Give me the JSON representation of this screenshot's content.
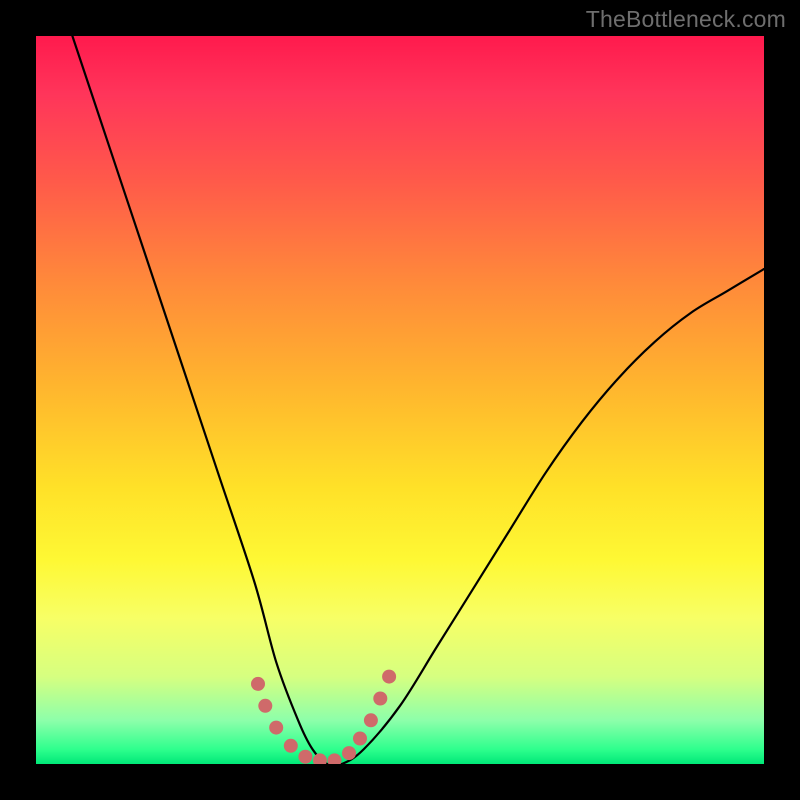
{
  "watermark": "TheBottleneck.com",
  "chart_data": {
    "type": "line",
    "title": "",
    "xlabel": "",
    "ylabel": "",
    "xlim": [
      0,
      100
    ],
    "ylim": [
      0,
      100
    ],
    "series": [
      {
        "name": "bottleneck-curve",
        "x": [
          5,
          10,
          15,
          20,
          25,
          30,
          33,
          36,
          38,
          40,
          42,
          45,
          50,
          55,
          60,
          65,
          70,
          75,
          80,
          85,
          90,
          95,
          100
        ],
        "y": [
          100,
          85,
          70,
          55,
          40,
          25,
          14,
          6,
          2,
          0,
          0,
          2,
          8,
          16,
          24,
          32,
          40,
          47,
          53,
          58,
          62,
          65,
          68
        ]
      }
    ],
    "markers": {
      "name": "highlight-dots",
      "x": [
        30.5,
        31.5,
        33,
        35,
        37,
        39,
        41,
        43,
        44.5,
        46,
        47.3,
        48.5
      ],
      "y": [
        11,
        8,
        5,
        2.5,
        1,
        0.5,
        0.5,
        1.5,
        3.5,
        6,
        9,
        12
      ]
    },
    "gradient_stops": [
      {
        "pos": 0,
        "color": "#ff1a4d"
      },
      {
        "pos": 34,
        "color": "#ff8a3a"
      },
      {
        "pos": 62,
        "color": "#ffe128"
      },
      {
        "pos": 88,
        "color": "#d6ff80"
      },
      {
        "pos": 100,
        "color": "#00e878"
      }
    ]
  }
}
